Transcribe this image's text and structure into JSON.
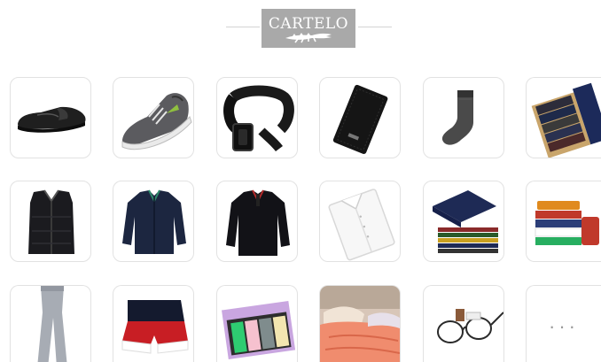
{
  "header": {
    "logo_text": "CARTELO",
    "logo_icon": "crocodile-icon",
    "logo_bg": "#a9a9a9"
  },
  "categories": [
    {
      "row": 1,
      "items": [
        "loafer-shoe-icon",
        "sneaker-icon",
        "belt-icon",
        "wallet-icon",
        "sock-icon",
        "sock-gift-box-icon"
      ]
    },
    {
      "row": 2,
      "items": [
        "vest-icon",
        "jacket-icon",
        "polo-long-sleeve-icon",
        "dress-shirt-icon",
        "folded-sweaters-icon",
        "folded-polos-icon"
      ]
    },
    {
      "row": 3,
      "items": [
        "leggings-icon",
        "swim-shorts-icon",
        "underwear-box-icon",
        "bedding-icon",
        "glasses-icon",
        "more-icon"
      ]
    }
  ],
  "more": {
    "label": "···"
  }
}
